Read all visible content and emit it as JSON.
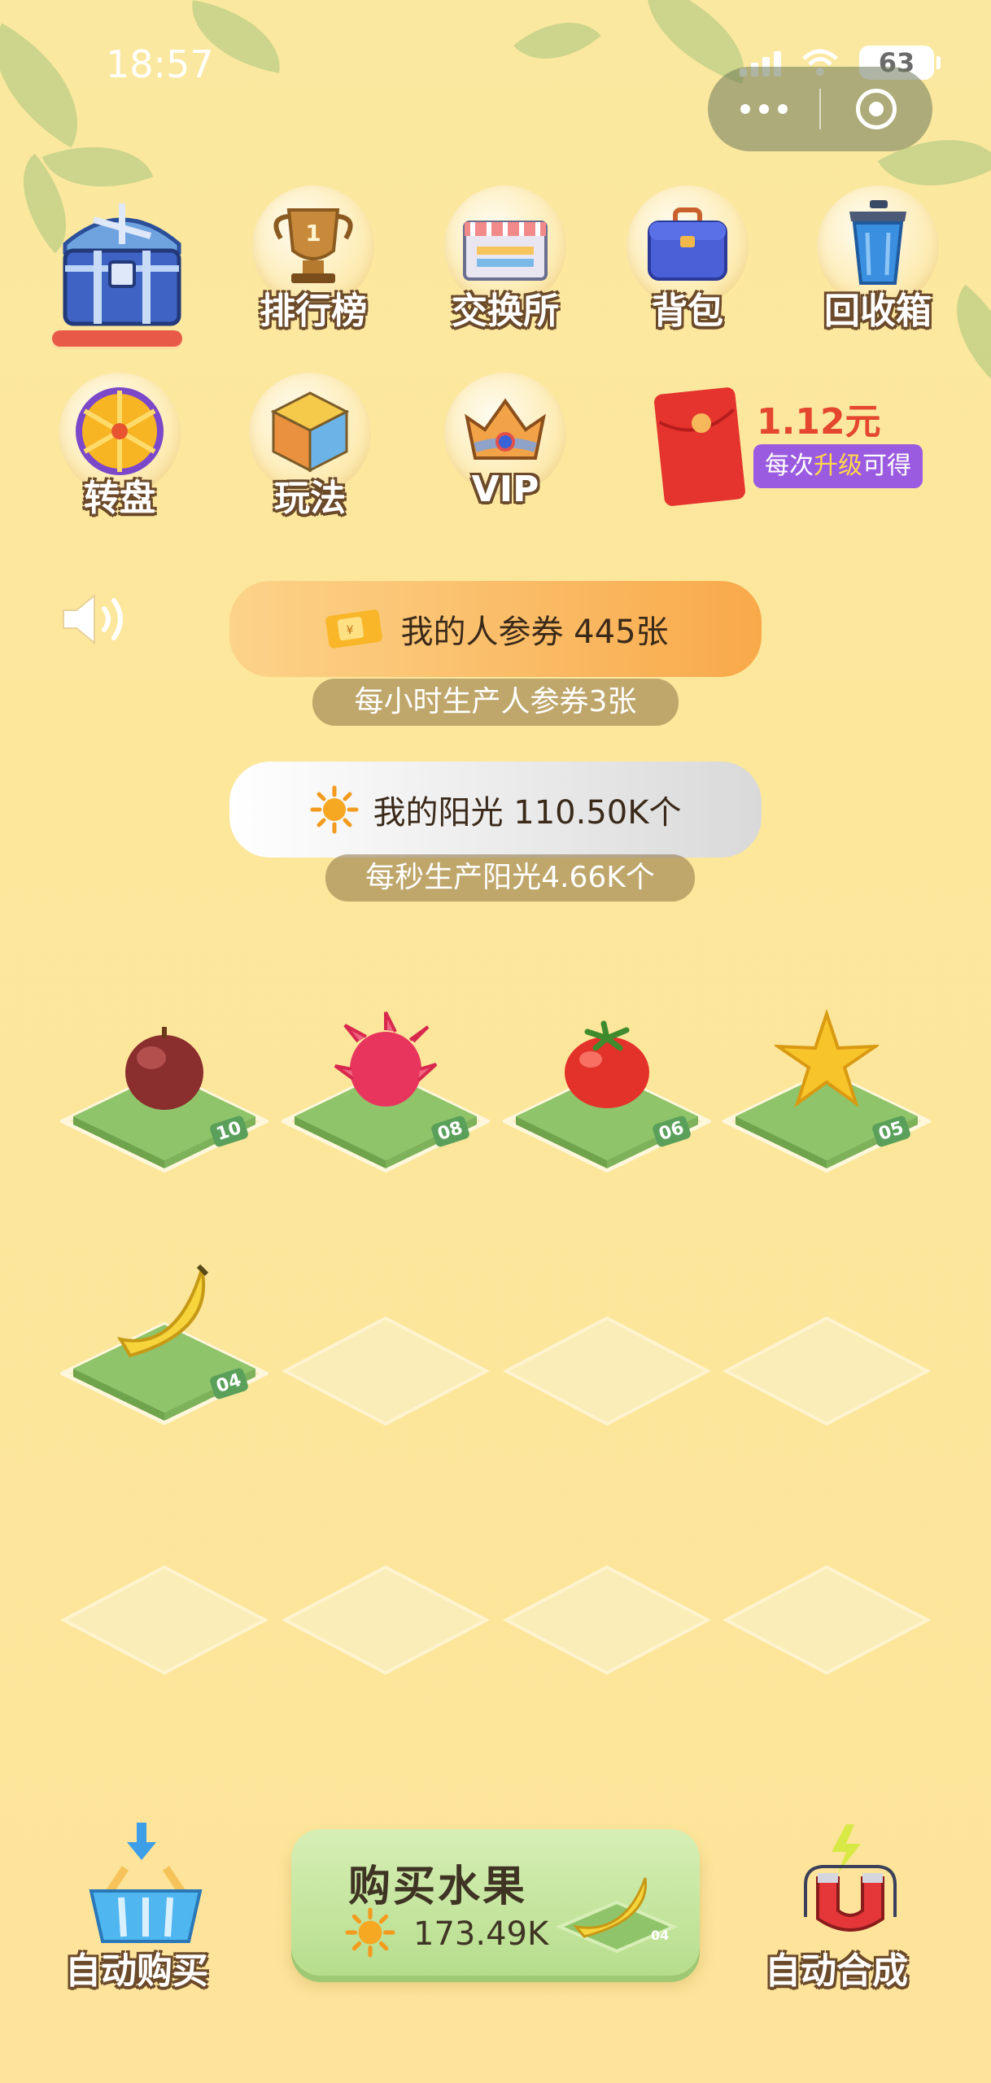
{
  "status_bar": {
    "time": "18:57",
    "battery": "63"
  },
  "top_menu": [
    {
      "label": "排行榜",
      "icon": "trophy-icon"
    },
    {
      "label": "交换所",
      "icon": "shop-icon"
    },
    {
      "label": "背包",
      "icon": "backpack-icon"
    },
    {
      "label": "回收箱",
      "icon": "trash-bin-icon"
    }
  ],
  "second_menu": [
    {
      "label": "转盘",
      "icon": "wheel-icon"
    },
    {
      "label": "玩法",
      "icon": "cube-icon"
    },
    {
      "label": "VIP",
      "icon": "crown-icon"
    }
  ],
  "red_packet": {
    "amount": "1.12元",
    "note_prefix": "每次",
    "note_highlight": "升级",
    "note_suffix": "可得"
  },
  "ticket": {
    "label": "我的人参券 445张",
    "rate": "每小时生产人参券3张"
  },
  "sunshine": {
    "label": "我的阳光 110.50K个",
    "rate": "每秒生产阳光4.66K个"
  },
  "grid": [
    {
      "fruit": "fig",
      "level": "10"
    },
    {
      "fruit": "dragonfruit",
      "level": "08"
    },
    {
      "fruit": "tomato",
      "level": "06"
    },
    {
      "fruit": "starfruit",
      "level": "05"
    },
    {
      "fruit": "banana",
      "level": "04"
    }
  ],
  "bottom": {
    "auto_buy": "自动购买",
    "buy_title": "购买水果",
    "buy_price": "173.49K",
    "buy_level": "04",
    "auto_merge": "自动合成"
  },
  "colors": {
    "accent_orange": "#f9a94a",
    "tile_green": "#8fc46a",
    "purple_badge": "#9b5be0",
    "red_text": "#e4462e"
  }
}
